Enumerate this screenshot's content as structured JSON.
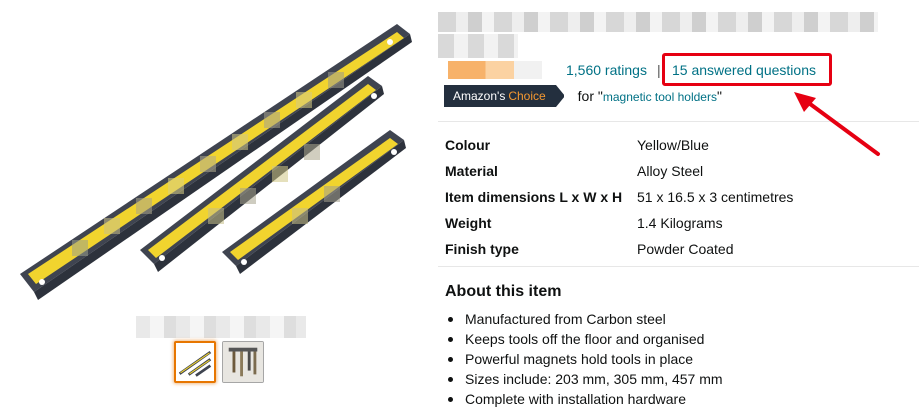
{
  "product": {
    "ratings_count": "1,560 ratings",
    "separator": "|",
    "answered_questions": "15 answered questions",
    "badge_prefix": "Amazon's",
    "badge_choice": "Choice",
    "for_label": "for",
    "keyword_open": "\"",
    "keyword": "magnetic tool holders",
    "keyword_close": "\""
  },
  "specs": [
    {
      "label": "Colour",
      "value": "Yellow/Blue"
    },
    {
      "label": "Material",
      "value": "Alloy Steel"
    },
    {
      "label": "Item dimensions L x W x H",
      "value": "51 x 16.5 x 3 centimetres"
    },
    {
      "label": "Weight",
      "value": "1.4 Kilograms"
    },
    {
      "label": "Finish type",
      "value": "Powder Coated"
    }
  ],
  "about": {
    "title": "About this item",
    "bullets": [
      "Manufactured from Carbon steel",
      "Keeps tools off the floor and organised",
      "Powerful magnets hold tools in place",
      "Sizes include: 203 mm, 305 mm, 457 mm",
      "Complete with installation hardware"
    ]
  },
  "colors": {
    "link": "#007185",
    "highlight_box": "#e60012",
    "badge_bg": "#232f3e",
    "badge_choice": "#f69931",
    "product_yellow": "#f1d42e"
  },
  "icons": {
    "arrow": "red-annotation-arrow-icon"
  }
}
